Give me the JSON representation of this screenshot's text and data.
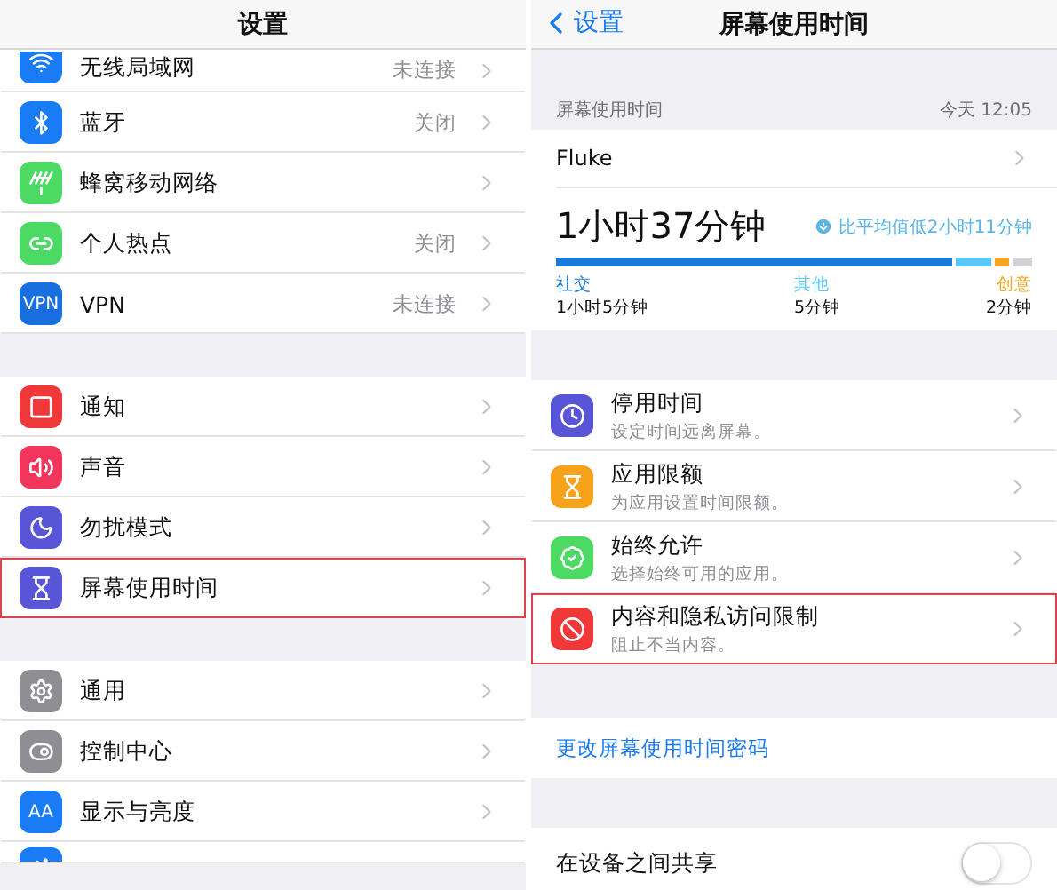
{
  "settings_screen": {
    "title": "设置",
    "groups": [
      {
        "rows": [
          {
            "kind": "wifi",
            "color": "#1a7cf5",
            "label": "无线局域网",
            "value": "未连接",
            "highlighted": false
          },
          {
            "kind": "bluetooth",
            "color": "#1a7cf5",
            "label": "蓝牙",
            "value": "关闭",
            "highlighted": false
          },
          {
            "kind": "antenna",
            "color": "#4cd964",
            "label": "蜂窝移动网络",
            "highlighted": false
          },
          {
            "kind": "link",
            "color": "#4cd964",
            "label": "个人热点",
            "value": "关闭",
            "highlighted": false
          },
          {
            "kind": "vpn",
            "color": "#1a6fe0",
            "icon_text": "VPN",
            "label": "VPN",
            "value": "未连接",
            "highlighted": false
          }
        ]
      },
      {
        "rows": [
          {
            "kind": "notify",
            "color": "#f0383a",
            "label": "通知",
            "highlighted": false
          },
          {
            "kind": "sound",
            "color": "#f2355a",
            "label": "声音",
            "highlighted": false
          },
          {
            "kind": "moon",
            "color": "#5856d6",
            "label": "勿扰模式",
            "highlighted": false
          },
          {
            "kind": "hourglass",
            "color": "#5856d6",
            "label": "屏幕使用时间",
            "highlighted": true
          }
        ]
      },
      {
        "rows": [
          {
            "kind": "gear",
            "color": "#8e8e93",
            "label": "通用",
            "highlighted": false
          },
          {
            "kind": "toggle",
            "color": "#8e8e93",
            "label": "控制中心",
            "highlighted": false
          },
          {
            "kind": "text",
            "color": "#1a7cf5",
            "icon_text": "AA",
            "label": "显示与亮度",
            "highlighted": false
          },
          {
            "kind": "person",
            "color": "#1a7cf5",
            "highlighted": false
          }
        ]
      }
    ]
  },
  "screen_time_screen": {
    "back": "设置",
    "title": "屏幕使用时间",
    "section_header": "屏幕使用时间",
    "section_date": "今天 12:05",
    "device": "Fluke",
    "total": "1小时37分钟",
    "comparison": "比平均值低2小时11分钟",
    "bar": [
      {
        "color": "#1a7ad9"
      },
      {
        "color": "#5ac8fa"
      },
      {
        "color": "#f5a623"
      },
      {
        "color": "#d1d1d6"
      }
    ],
    "legend": [
      {
        "name": "社交",
        "time": "1小时5分钟",
        "color": "#1a7ad9"
      },
      {
        "name": "其他",
        "time": "5分钟",
        "color": "#5ac8fa"
      },
      {
        "name": "创意",
        "time": "2分钟",
        "color": "#f5a623"
      }
    ],
    "rows": [
      {
        "kind": "clock",
        "color": "#5856d6",
        "title": "停用时间",
        "subtitle": "设定时间远离屏幕。",
        "highlighted": false
      },
      {
        "kind": "hourglass",
        "color": "#f7a21b",
        "title": "应用限额",
        "subtitle": "为应用设置时间限额。",
        "highlighted": false
      },
      {
        "kind": "check",
        "color": "#4cd964",
        "title": "始终允许",
        "subtitle": "选择始终可用的应用。",
        "highlighted": false
      },
      {
        "kind": "ban",
        "color": "#f0383a",
        "title": "内容和隐私访问限制",
        "subtitle": "阻止不当内容。",
        "highlighted": true
      }
    ],
    "passcode_link": "更改屏幕使用时间密码",
    "share": {
      "label": "在设备之间共享",
      "on": false
    }
  }
}
